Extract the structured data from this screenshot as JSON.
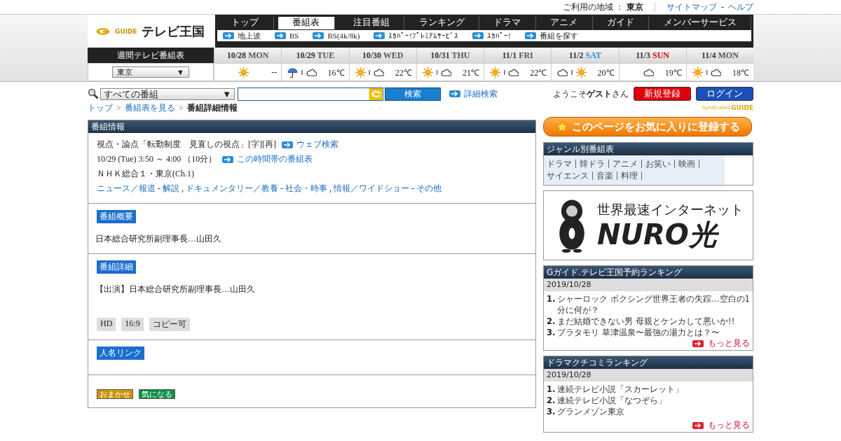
{
  "top_bar": {
    "region_label": "ご利用の地域 ：",
    "region": "東京",
    "links": [
      "サイトマップ",
      "ヘルプ"
    ],
    "separator": "-"
  },
  "logo": {
    "mark": "GUIDE",
    "title": "テレビ王国"
  },
  "nav": [
    {
      "label": "トップ",
      "selected": false
    },
    {
      "label": "番組表",
      "selected": true
    },
    {
      "label": "注目番組",
      "selected": false
    },
    {
      "label": "ランキング",
      "selected": false
    },
    {
      "label": "ドラマ",
      "selected": false
    },
    {
      "label": "アニメ",
      "selected": false
    },
    {
      "label": "ガイド",
      "selected": false
    },
    {
      "label": "メンバーサービス",
      "selected": false
    }
  ],
  "subnav": [
    "地上波",
    "BS",
    "BS(4k/8k)",
    "ｽｶﾊﾟｰ!ﾌﾟﾚﾐｱﾑｻｰﾋﾞｽ",
    "ｽｶﾊﾟｰ!",
    "番組を探す"
  ],
  "week": {
    "title": "週間テレビ番組表",
    "region_select": "東京",
    "select_arrow": "▼",
    "weather_separator": "‖",
    "days": [
      {
        "date": "10/28",
        "weekday": "MON",
        "kind": "weekday",
        "weather": [
          {
            "kind": "sun"
          }
        ],
        "temp": "--"
      },
      {
        "date": "10/29",
        "weekday": "TUE",
        "kind": "weekday",
        "weather": [
          {
            "kind": "rain"
          },
          {
            "kind": "cloud"
          }
        ],
        "temp": "16℃"
      },
      {
        "date": "10/30",
        "weekday": "WED",
        "kind": "weekday",
        "weather": [
          {
            "kind": "sun"
          },
          {
            "kind": "cloud"
          }
        ],
        "temp": "22℃"
      },
      {
        "date": "10/31",
        "weekday": "THU",
        "kind": "weekday",
        "weather": [
          {
            "kind": "sun"
          },
          {
            "kind": "cloud"
          }
        ],
        "temp": "21℃"
      },
      {
        "date": "11/1",
        "weekday": "FRI",
        "kind": "weekday",
        "weather": [
          {
            "kind": "sun"
          },
          {
            "kind": "cloud"
          }
        ],
        "temp": "22℃"
      },
      {
        "date": "11/2",
        "weekday": "SAT",
        "kind": "saturday",
        "weather": [
          {
            "kind": "cloud"
          },
          {
            "kind": "sun"
          }
        ],
        "temp": "20℃"
      },
      {
        "date": "11/3",
        "weekday": "SUN",
        "kind": "sunday",
        "weather": [
          {
            "kind": "cloud"
          }
        ],
        "temp": "19℃"
      },
      {
        "date": "11/4",
        "weekday": "MON",
        "kind": "weekday",
        "weather": [
          {
            "kind": "sun"
          },
          {
            "kind": "cloud"
          }
        ],
        "temp": "18℃"
      }
    ]
  },
  "search": {
    "scope": "すべての番組",
    "arrow": "▼",
    "button": "検索",
    "advanced": "詳細検索"
  },
  "welcome": {
    "prefix": "ようこそ",
    "user": "ゲスト",
    "suffix": "さん",
    "register": "新規登録",
    "login": "ログイン",
    "syndicated": "Syndicated",
    "guide": "GUIDE"
  },
  "breadcrumb": [
    {
      "label": "トップ",
      "kind": "link"
    },
    {
      "label": "番組表を見る",
      "kind": "link"
    },
    {
      "label": "番組詳細情報",
      "kind": "current"
    }
  ],
  "breadcrumb_separator": ">",
  "program": {
    "header": "番組情報",
    "title": "視点・論点「転勤制度　見直しの視点」[字][再]",
    "web_search": "ウェブ検索",
    "time": "10/29 (Tue) 3:50 ～ 4:00 （10分）",
    "time_link": "この時間帯の番組表",
    "channel": "ＮＨＫ総合１・東京(Ch.1)",
    "genres": [
      {
        "label": "ニュース／報道",
        "sep": "-"
      },
      {
        "label": "解説",
        "sep": ","
      },
      {
        "label": "ドキュメンタリー／教養",
        "sep": "-"
      },
      {
        "label": "社会・時事",
        "sep": ","
      },
      {
        "label": "情報／ワイドショー",
        "sep": "-"
      },
      {
        "label": "その他"
      }
    ],
    "summary_label": "番組概要",
    "summary": "日本総合研究所副理事長…山田久",
    "detail_label": "番組詳細",
    "detail": "【出演】日本総合研究所副理事長…山田久",
    "tags": [
      "HD",
      "16:9",
      "コピー可"
    ],
    "people_label": "人名リンク",
    "actions": [
      {
        "label": "おまかせ",
        "color": "#c8960c"
      },
      {
        "label": "気になる",
        "color": "#109048"
      }
    ]
  },
  "favorite_button": "このページをお気に入りに登録する",
  "genre_table": {
    "title": "ジャンル別番組表",
    "items": [
      "ドラマ",
      "韓ドラ",
      "アニメ",
      "お笑い",
      "映画",
      "サイエンス",
      "音楽",
      "料理"
    ]
  },
  "ad": {
    "tagline": "世界最速インターネット",
    "brand": "NURO光"
  },
  "rankings": [
    {
      "title": "Gガイド.テレビ王国予約ランキング",
      "date": "2019/10/28",
      "items": [
        {
          "rank": "1.",
          "title": "シャーロック ボクシング世界王者の失踪…空白の1分に何が？"
        },
        {
          "rank": "2.",
          "title": "まだ結婚できない男 母親とケンカして悪いか!!"
        },
        {
          "rank": "3.",
          "title": "ブラタモリ 草津温泉〜最強の湯力とは？〜"
        }
      ],
      "more": "もっと見る"
    },
    {
      "title": "ドラマクチコミランキング",
      "date": "2019/10/28",
      "items": [
        {
          "rank": "1.",
          "title": "連続テレビ小説「スカーレット」"
        },
        {
          "rank": "2.",
          "title": "連続テレビ小説「なつぞら」"
        },
        {
          "rank": "3.",
          "title": "グランメゾン東京"
        }
      ],
      "more": "もっと見る"
    }
  ]
}
